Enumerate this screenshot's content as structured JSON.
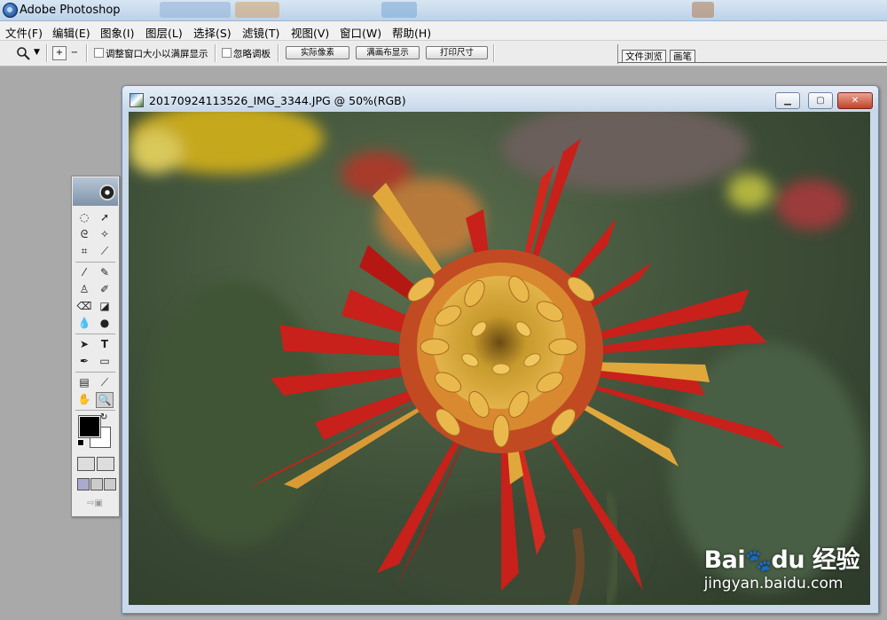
{
  "app": {
    "title": "Adobe Photoshop"
  },
  "menu": [
    {
      "label": "文件(F)"
    },
    {
      "label": "编辑(E)"
    },
    {
      "label": "图象(I)"
    },
    {
      "label": "图层(L)"
    },
    {
      "label": "选择(S)"
    },
    {
      "label": "滤镜(T)"
    },
    {
      "label": "视图(V)"
    },
    {
      "label": "窗口(W)"
    },
    {
      "label": "帮助(H)"
    }
  ],
  "options_bar": {
    "tool_icon": "zoom-icon",
    "resize_windows_label": "调整窗口大小以满屏显示",
    "ignore_palettes_label": "忽略调板",
    "actual_pixels_label": "实际像素",
    "fit_on_screen_label": "满画布显示",
    "print_size_label": "打印尺寸"
  },
  "palette_well": {
    "tabs": [
      "文件浏览",
      "画笔"
    ]
  },
  "document": {
    "title": "20170924113526_IMG_3344.JPG @ 50%(RGB)",
    "min_icon": "minimize-icon",
    "max_icon": "maximize-icon",
    "close_icon": "close-icon"
  },
  "watermark": {
    "brand_bai": "Bai",
    "brand_du": "du",
    "brand_cn": "经验",
    "url": "jingyan.baidu.com"
  },
  "toolbox": {
    "type_tool_glyph": "T"
  },
  "colors": {
    "accent_close": "#c1432a",
    "foreground": "#000000",
    "background": "#ffffff",
    "petal_red": "#c8201a",
    "petal_yellow": "#e0a83a"
  }
}
